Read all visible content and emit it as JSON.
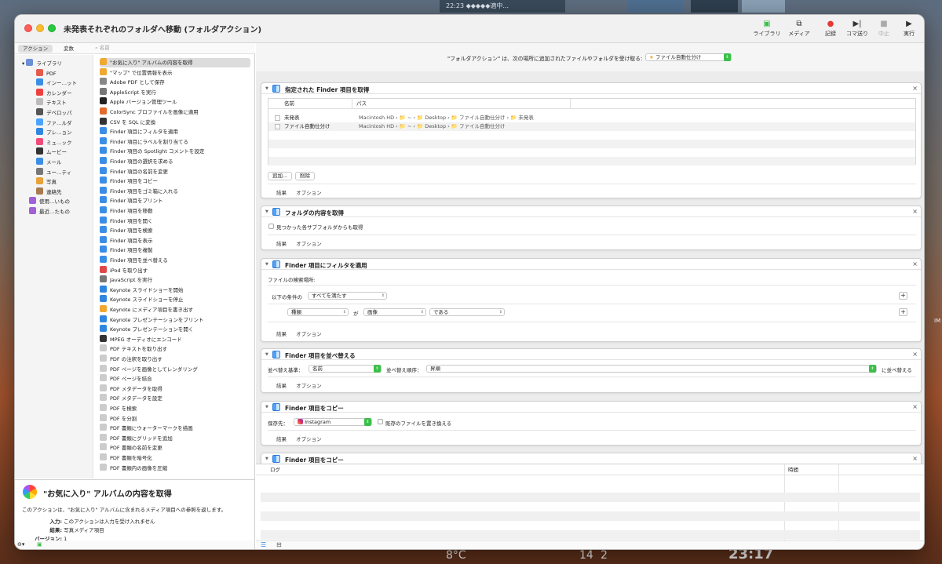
{
  "window": {
    "title": "未発表それぞれのフォルダへ移動 (フォルダアクション)",
    "toolbar": [
      {
        "label": "ライブラリ",
        "icon": "library-icon",
        "enabled": true
      },
      {
        "label": "メディア",
        "icon": "media-icon",
        "enabled": true
      },
      {
        "label": "記録",
        "icon": "record-icon",
        "enabled": true
      },
      {
        "label": "コマ送り",
        "icon": "step-icon",
        "enabled": true
      },
      {
        "label": "中止",
        "icon": "stop-icon",
        "enabled": false
      },
      {
        "label": "実行",
        "icon": "run-icon",
        "enabled": true
      }
    ]
  },
  "desktop": {
    "clock_strip": "22:23 ◆◆◆◆◆適中...",
    "temp": "8°C",
    "date_small": "14",
    "date_small2": "2",
    "clock_big": "23:17",
    "edge_label": "IM"
  },
  "library": {
    "tabs": [
      "アクション",
      "変数"
    ],
    "search_placeholder": "名前",
    "items": [
      {
        "label": "ライブラリ",
        "color": "#6b8fd6",
        "indent": 0
      },
      {
        "label": "PDF",
        "color": "#e45b4b",
        "indent": 1
      },
      {
        "label": "インー…ット",
        "color": "#3a8ee6",
        "indent": 1
      },
      {
        "label": "カレンダー",
        "color": "#ef4040",
        "indent": 1
      },
      {
        "label": "テキスト",
        "color": "#bbbbbb",
        "indent": 1
      },
      {
        "label": "デベロッパ",
        "color": "#555555",
        "indent": 1
      },
      {
        "label": "ファ…ルダ",
        "color": "#4aa3ff",
        "indent": 1
      },
      {
        "label": "プレ…ョン",
        "color": "#2f86e0",
        "indent": 1
      },
      {
        "label": "ミュ…ック",
        "color": "#f24b7a",
        "indent": 1
      },
      {
        "label": "ムービー",
        "color": "#333333",
        "indent": 1
      },
      {
        "label": "メール",
        "color": "#3a8ee6",
        "indent": 1
      },
      {
        "label": "ユー…ティ",
        "color": "#777777",
        "indent": 1
      },
      {
        "label": "写真",
        "color": "#e8a23a",
        "indent": 1
      },
      {
        "label": "連絡先",
        "color": "#a87a4e",
        "indent": 1
      },
      {
        "label": "使用…いもの",
        "color": "#a25fd6",
        "indent": 0
      },
      {
        "label": "最近…たもの",
        "color": "#a25fd6",
        "indent": 0
      }
    ]
  },
  "actions": [
    {
      "label": "\"お気に入り\" アルバムの内容を取得",
      "color": "#f0a830",
      "selected": true
    },
    {
      "label": "\"マップ\" で位置情報を表示",
      "color": "#f0a830"
    },
    {
      "label": "Adobe PDF として保存",
      "color": "#888888"
    },
    {
      "label": "AppleScript を実行",
      "color": "#777777"
    },
    {
      "label": "Apple バージョン管理ツール",
      "color": "#222222"
    },
    {
      "label": "ColorSync プロファイルを画像に適用",
      "color": "#e36b2e"
    },
    {
      "label": "CSV を SQL に変換",
      "color": "#333333"
    },
    {
      "label": "Finder 項目にフィルタを適用",
      "color": "#3a8ee6"
    },
    {
      "label": "Finder 項目にラベルを割り当てる",
      "color": "#3a8ee6"
    },
    {
      "label": "Finder 項目の Spotlight コメントを設定",
      "color": "#3a8ee6"
    },
    {
      "label": "Finder 項目の選択を求める",
      "color": "#3a8ee6"
    },
    {
      "label": "Finder 項目の名前を変更",
      "color": "#3a8ee6"
    },
    {
      "label": "Finder 項目をコピー",
      "color": "#3a8ee6"
    },
    {
      "label": "Finder 項目をゴミ箱に入れる",
      "color": "#3a8ee6"
    },
    {
      "label": "Finder 項目をプリント",
      "color": "#3a8ee6"
    },
    {
      "label": "Finder 項目を移動",
      "color": "#3a8ee6"
    },
    {
      "label": "Finder 項目を開く",
      "color": "#3a8ee6"
    },
    {
      "label": "Finder 項目を検索",
      "color": "#3a8ee6"
    },
    {
      "label": "Finder 項目を表示",
      "color": "#3a8ee6"
    },
    {
      "label": "Finder 項目を複製",
      "color": "#3a8ee6"
    },
    {
      "label": "Finder 項目を並べ替える",
      "color": "#3a8ee6"
    },
    {
      "label": "iPod を取り出す",
      "color": "#e04848"
    },
    {
      "label": "JavaScript を実行",
      "color": "#777777"
    },
    {
      "label": "Keynote スライドショーを開始",
      "color": "#2f86e0"
    },
    {
      "label": "Keynote スライドショーを停止",
      "color": "#2f86e0"
    },
    {
      "label": "Keynote にメディア項目を書き出す",
      "color": "#f0a830"
    },
    {
      "label": "Keynote プレゼンテーションをプリント",
      "color": "#2f86e0"
    },
    {
      "label": "Keynote プレゼンテーションを開く",
      "color": "#2f86e0"
    },
    {
      "label": "MPEG オーディオにエンコード",
      "color": "#333333"
    },
    {
      "label": "PDF テキストを取り出す",
      "color": "#cccccc"
    },
    {
      "label": "PDF の注釈を取り出す",
      "color": "#cccccc"
    },
    {
      "label": "PDF ページを画像としてレンダリング",
      "color": "#cccccc"
    },
    {
      "label": "PDF ページを結合",
      "color": "#cccccc"
    },
    {
      "label": "PDF メタデータを取得",
      "color": "#cccccc"
    },
    {
      "label": "PDF メタデータを設定",
      "color": "#cccccc"
    },
    {
      "label": "PDF を検索",
      "color": "#cccccc"
    },
    {
      "label": "PDF を分割",
      "color": "#cccccc"
    },
    {
      "label": "PDF 書類にウォーターマークを描画",
      "color": "#cccccc"
    },
    {
      "label": "PDF 書類にグリッドを追加",
      "color": "#cccccc"
    },
    {
      "label": "PDF 書類の名前を変更",
      "color": "#cccccc"
    },
    {
      "label": "PDF 書類を暗号化",
      "color": "#cccccc"
    },
    {
      "label": "PDF 書類内の画像を圧縮",
      "color": "#cccccc"
    }
  ],
  "description": {
    "title": "\"お気に入り\" アルバムの内容を取得",
    "body": "このアクションは、\"お気に入り\" アルバムに含まれるメディア項目への参照を返します。",
    "input_label": "入力:",
    "input_value": "このアクションは入力を受け入れません",
    "result_label": "結果:",
    "result_value": "写真メディア項目",
    "version_label": "バージョン:",
    "version_value": "1"
  },
  "workflow": {
    "header_text": "\"フォルダアクション\" は、次の場所に追加されたファイルやフォルダを受け取る:",
    "folder": "ファイル自動仕分け",
    "footer_labels": [
      "結果",
      "オプション"
    ],
    "card1": {
      "title": "指定された Finder 項目を取得",
      "col_name": "名前",
      "col_path": "パス",
      "rows": [
        {
          "name": "未発表",
          "path": "Macintosh HD › 📁 ~ › 📁 Desktop › 📁 ファイル自動仕分け › 📁 未発表"
        },
        {
          "name": "ファイル自動仕分け",
          "path": "Macintosh HD › 📁 ~ › 📁 Desktop › 📁 ファイル自動仕分け"
        }
      ],
      "add": "追加...",
      "remove": "削除"
    },
    "card2": {
      "title": "フォルダの内容を取得",
      "checkbox": "見つかった各サブフォルダからも取得"
    },
    "card3": {
      "title": "Finder 項目にフィルタを適用",
      "search_label": "ファイルの検索場所:",
      "cond_label": "以下の条件の",
      "cond_value": "すべてを満たす",
      "field1": "種類",
      "ga": "が",
      "field2": "画像",
      "field3": "である"
    },
    "card4": {
      "title": "Finder 項目を並べ替える",
      "sort_by_label": "並べ替え基準：",
      "sort_by": "名前",
      "order_label": "並べ替え順序：",
      "order": "昇順",
      "suffix": "に並べ替える"
    },
    "card5": {
      "title": "Finder 項目をコピー",
      "dest_label": "保存先：",
      "dest": "Instagram",
      "replace": "既存のファイルを置き換える"
    },
    "card6": {
      "title": "Finder 項目をコピー"
    }
  },
  "log": {
    "col_log": "ログ",
    "col_time": "時間"
  }
}
